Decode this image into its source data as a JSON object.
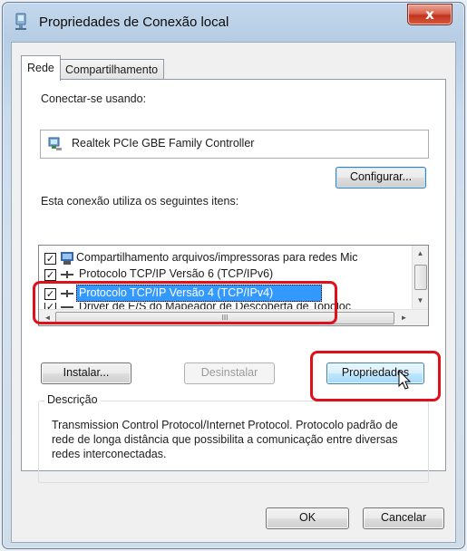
{
  "window": {
    "title": "Propriedades de Conexão local",
    "close_glyph": "x"
  },
  "tabs": [
    {
      "label": "Rede",
      "active": true
    },
    {
      "label": "Compartilhamento",
      "active": false
    }
  ],
  "connect_using": {
    "label": "Conectar-se usando:",
    "adapter": "Realtek PCIe GBE Family Controller",
    "adapter_icon": "network-adapter-icon"
  },
  "configure_button": "Configurar...",
  "items_label": "Esta conexão utiliza os seguintes itens:",
  "items": [
    {
      "checked": true,
      "icon": "file-printer-sharing-icon",
      "label": "Compartilhamento arquivos/impressoras para redes Mic"
    },
    {
      "checked": true,
      "icon": "protocol-icon",
      "label": "Protocolo TCP/IP Versão 6 (TCP/IPv6)"
    },
    {
      "checked": true,
      "icon": "protocol-icon",
      "label": "Protocolo TCP/IP Versão 4 (TCP/IPv4)",
      "selected": true
    },
    {
      "checked": true,
      "icon": "protocol-icon",
      "label": "Driver de E/S do Mapeador de Descoberta de Topoloc"
    }
  ],
  "scroll_symbols": {
    "up": "▲",
    "down": "▼",
    "left": "◄",
    "right": "►",
    "grip": "III"
  },
  "action_buttons": {
    "install": "Instalar...",
    "uninstall": "Desinstalar",
    "properties": "Propriedades"
  },
  "description": {
    "legend": "Descrição",
    "text": "Transmission Control Protocol/Internet Protocol. Protocolo padrão de rede de longa distância que possibilita a comunicação entre diversas redes interconectadas."
  },
  "footer": {
    "ok": "OK",
    "cancel": "Cancelar"
  },
  "colors": {
    "highlight": "#e0101a",
    "selection": "#3399ff"
  }
}
